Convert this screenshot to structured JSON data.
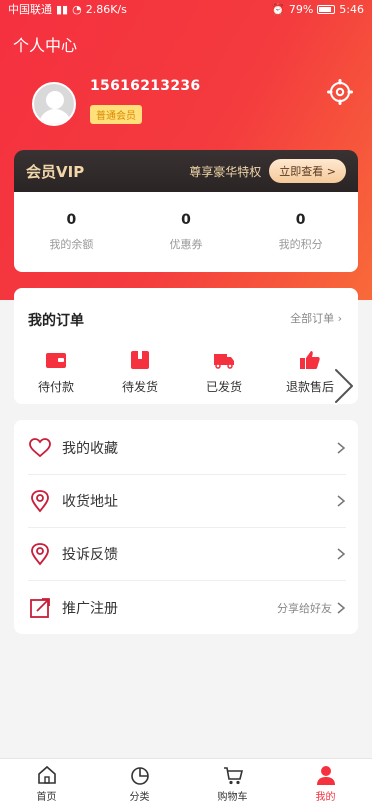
{
  "status_bar": {
    "carrier": "中国联通",
    "speed": "2.86K/s",
    "battery": "79%",
    "time": "5:46"
  },
  "header": {
    "title": "个人中心",
    "phone": "15616213236",
    "level": "普通会员"
  },
  "vip": {
    "title": "会员VIP",
    "desc": "尊享豪华特权",
    "button": "立即查看 >"
  },
  "stats": [
    {
      "value": "0",
      "label": "我的余额"
    },
    {
      "value": "0",
      "label": "优惠券"
    },
    {
      "value": "0",
      "label": "我的积分"
    }
  ],
  "orders": {
    "title": "我的订单",
    "all_label": "全部订单",
    "items": [
      {
        "label": "待付款",
        "icon": "wallet-icon"
      },
      {
        "label": "待发货",
        "icon": "package-icon"
      },
      {
        "label": "已发货",
        "icon": "truck-icon"
      },
      {
        "label": "退款售后",
        "icon": "thumb-up-icon"
      }
    ]
  },
  "menu": {
    "items": [
      {
        "label": "我的收藏",
        "extra": "",
        "icon": "heart-icon"
      },
      {
        "label": "收货地址",
        "extra": "",
        "icon": "location-icon"
      },
      {
        "label": "投诉反馈",
        "extra": "",
        "icon": "location-icon"
      },
      {
        "label": "推广注册",
        "extra": "分享给好友",
        "icon": "share-icon"
      }
    ]
  },
  "tabbar": {
    "items": [
      {
        "label": "首页",
        "icon": "home-icon"
      },
      {
        "label": "分类",
        "icon": "category-icon"
      },
      {
        "label": "购物车",
        "icon": "cart-icon"
      },
      {
        "label": "我的",
        "icon": "user-icon"
      }
    ]
  },
  "colors": {
    "accent": "#f5303f",
    "vip_gold": "#f0d6a8"
  }
}
